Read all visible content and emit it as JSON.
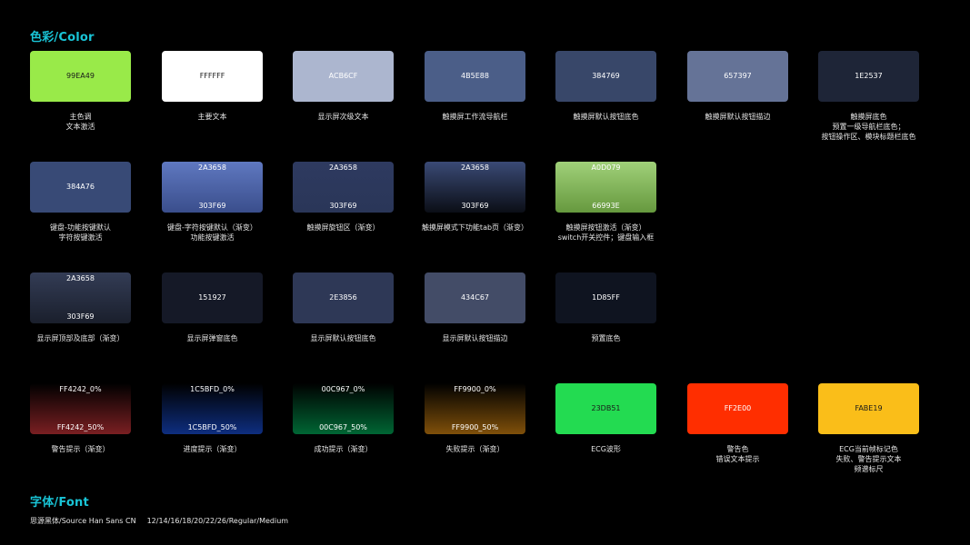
{
  "titles": {
    "color": "色彩/Color",
    "font": "字体/Font"
  },
  "swatches": [
    {
      "hex": "99EA49",
      "text_color": "#1a1a1a",
      "fill": "#99EA49",
      "caption": [
        "主色调",
        "文本激活"
      ]
    },
    {
      "hex": "FFFFFF",
      "text_color": "#1a1a1a",
      "fill": "#FFFFFF",
      "caption": [
        "主要文本"
      ]
    },
    {
      "hex": "ACB6CF",
      "text_color": "#ffffff",
      "fill": "#ACB6CF",
      "caption": [
        "显示屏次级文本"
      ]
    },
    {
      "hex": "4B5E88",
      "text_color": "#ffffff",
      "fill": "#4B5E88",
      "caption": [
        "触摸屏工作流导航栏"
      ]
    },
    {
      "hex": "384769",
      "text_color": "#ffffff",
      "fill": "#384769",
      "caption": [
        "触摸屏默认按钮底色"
      ]
    },
    {
      "hex": "657397",
      "text_color": "#ffffff",
      "fill": "#657397",
      "caption": [
        "触摸屏默认按钮描边"
      ]
    },
    {
      "hex": "1E2537",
      "text_color": "#ffffff",
      "fill": "#1E2537",
      "caption": [
        "触摸屏底色",
        "预置一级导航栏底色；",
        "按钮操作区、模块标题栏底色"
      ]
    },
    {
      "hex": "384A76",
      "text_color": "#ffffff",
      "fill": "#384A76",
      "caption": [
        "键盘-功能按键默认",
        "字符按键激活"
      ]
    },
    {
      "hex_top": "2A3658",
      "hex_bottom": "303F69",
      "text_color": "#ffffff",
      "gradient": [
        "#5F78C0",
        "#3A4E8C"
      ],
      "caption": [
        "键盘-字符按键默认（渐变）",
        "功能按键激活"
      ]
    },
    {
      "hex_top": "2A3658",
      "hex_bottom": "303F69",
      "text_color": "#ffffff",
      "gradient": [
        "#2E3A60",
        "#2A3658"
      ],
      "caption": [
        "触摸屏旋钮区（渐变）"
      ]
    },
    {
      "hex_top": "2A3658",
      "hex_bottom": "303F69",
      "text_color": "#ffffff",
      "gradient": [
        "#3A4A75",
        "#0B0E16"
      ],
      "caption": [
        "触摸屏模式下功能tab页（渐变）"
      ]
    },
    {
      "hex_top": "A0D079",
      "hex_bottom": "66993E",
      "text_color": "#ffffff",
      "gradient": [
        "#A0D079",
        "#66993E"
      ],
      "caption": [
        "触摸屏按钮激活（渐变）",
        "switch开关控件；键盘输入框"
      ]
    },
    {
      "hex_top": "2A3658",
      "hex_bottom": "303F69",
      "text_color": "#ffffff",
      "gradient": [
        "#333C55",
        "#1A1F2C"
      ],
      "caption": [
        "显示屏顶部及底部（渐变）"
      ]
    },
    {
      "hex": "151927",
      "text_color": "#ffffff",
      "fill": "#151927",
      "caption": [
        "显示屏弹窗底色"
      ]
    },
    {
      "hex": "2E3856",
      "text_color": "#ffffff",
      "fill": "#2E3856",
      "caption": [
        "显示屏默认按钮底色"
      ]
    },
    {
      "hex": "434C67",
      "text_color": "#ffffff",
      "fill": "#434C67",
      "caption": [
        "显示屏默认按钮描边"
      ]
    },
    {
      "hex": "1D85FF",
      "text_color": "#ffffff",
      "fill": "#0F1420",
      "caption": [
        "预置底色"
      ]
    },
    {
      "hex_top": "FF4242_0%",
      "hex_bottom": "FF4242_50%",
      "text_color": "#ffffff",
      "gradient": [
        "#000000",
        "#7A1F22"
      ],
      "caption": [
        "警告提示（渐变）"
      ]
    },
    {
      "hex_top": "1C5BFD_0%",
      "hex_bottom": "1C5BFD_50%",
      "text_color": "#ffffff",
      "gradient": [
        "#000000",
        "#0E2E80"
      ],
      "caption": [
        "进度提示（渐变）"
      ]
    },
    {
      "hex_top": "00C967_0%",
      "hex_bottom": "00C967_50%",
      "text_color": "#ffffff",
      "gradient": [
        "#000000",
        "#006634"
      ],
      "caption": [
        "成功提示（渐变）"
      ]
    },
    {
      "hex_top": "FF9900_0%",
      "hex_bottom": "FF9900_50%",
      "text_color": "#ffffff",
      "gradient": [
        "#000000",
        "#80500A"
      ],
      "caption": [
        "失败提示（渐变）"
      ]
    },
    {
      "hex": "23DB51",
      "text_color": "#1a1a1a",
      "fill": "#23DB51",
      "caption": [
        "ECG波形"
      ]
    },
    {
      "hex": "FF2E00",
      "text_color": "#ffffff",
      "fill": "#FF2E00",
      "caption": [
        "警告色",
        "错误文本提示"
      ]
    },
    {
      "hex": "FABE19",
      "text_color": "#1a1a1a",
      "fill": "#FABE19",
      "caption": [
        "ECG当前帧标记色",
        "失败、警告提示文本",
        "频谱标尺"
      ]
    }
  ],
  "font": {
    "family": "思源黑体/Source Han Sans CN",
    "specs": "12/14/16/18/20/22/26/Regular/Medium"
  }
}
